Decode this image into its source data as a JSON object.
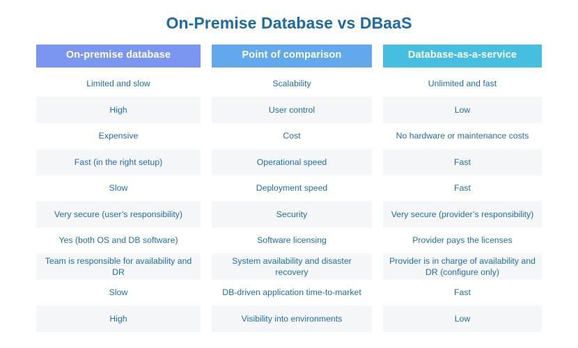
{
  "title": "On-Premise Database vs DBaaS",
  "colors": {
    "title": "#1b6ba8",
    "body_text": "#1c6ea8",
    "header_1_bg": "#7b96f0",
    "header_2_bg": "#62a8ec",
    "header_3_bg": "#45bee0",
    "shaded_row_bg": "#f5f6f7",
    "page_bg": "#ffffff"
  },
  "table": {
    "headers": [
      "On-premise database",
      "Point of comparison",
      "Database-as-a-service"
    ],
    "rows": [
      {
        "shaded": false,
        "cells": [
          "Limited and slow",
          "Scalability",
          "Unlimited and fast"
        ]
      },
      {
        "shaded": true,
        "cells": [
          "High",
          "User control",
          "Low"
        ]
      },
      {
        "shaded": false,
        "cells": [
          "Expensive",
          "Cost",
          "No hardware or maintenance costs"
        ]
      },
      {
        "shaded": true,
        "cells": [
          "Fast (in the right setup)",
          "Operational speed",
          "Fast"
        ]
      },
      {
        "shaded": false,
        "cells": [
          "Slow",
          "Deployment speed",
          "Fast"
        ]
      },
      {
        "shaded": true,
        "cells": [
          "Very secure (user’s responsibility)",
          "Security",
          "Very secure (provider’s responsibility)"
        ]
      },
      {
        "shaded": false,
        "cells": [
          "Yes (both OS and DB software)",
          "Software licensing",
          "Provider pays the licenses"
        ]
      },
      {
        "shaded": true,
        "cells": [
          "Team is responsible for availability and DR",
          "System availability and disaster recovery",
          "Provider is in charge of availability and DR (configure only)"
        ]
      },
      {
        "shaded": false,
        "cells": [
          "Slow",
          "DB-driven application time-to-market",
          "Fast"
        ]
      },
      {
        "shaded": true,
        "cells": [
          "High",
          "Visibility into environments",
          "Low"
        ]
      }
    ]
  }
}
